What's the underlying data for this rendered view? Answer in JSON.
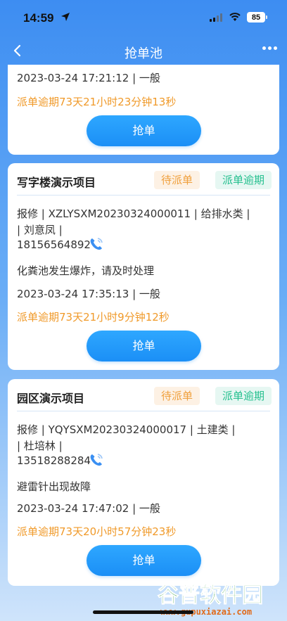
{
  "status": {
    "time": "14:59",
    "battery": "85"
  },
  "nav": {
    "title": "抢单池"
  },
  "cards": [
    {
      "datetime_level": "2023-03-24 17:21:12 | 一般",
      "overdue_text": "派单逾期73天21小时23分钟13秒",
      "button": "抢单"
    },
    {
      "title": "写字楼演示项目",
      "badge_pending": "待派单",
      "badge_overdue": "派单逾期",
      "info_line1": "报修 | XZLYSXM20230324000011 | 给排水类 |",
      "info_line2": "| 刘意凤 |",
      "phone": "18156564892",
      "description": "化粪池发生爆炸，请及时处理",
      "datetime_level": "2023-03-24 17:35:13 | 一般",
      "overdue_text": "派单逾期73天21小时9分钟12秒",
      "button": "抢单"
    },
    {
      "title": "园区演示项目",
      "badge_pending": "待派单",
      "badge_overdue": "派单逾期",
      "info_line1": "报修 | YQYSXM20230324000017 | 土建类 |",
      "info_line2": "| 杜培林 |",
      "phone": "13518288284",
      "description": "避雷针出现故障",
      "datetime_level": "2023-03-24 17:47:02 | 一般",
      "overdue_text": "派单逾期73天20小时57分钟23秒",
      "button": "抢单"
    }
  ],
  "watermark": {
    "text": "谷普软件园",
    "url": "www.gupuxiazai.com"
  }
}
